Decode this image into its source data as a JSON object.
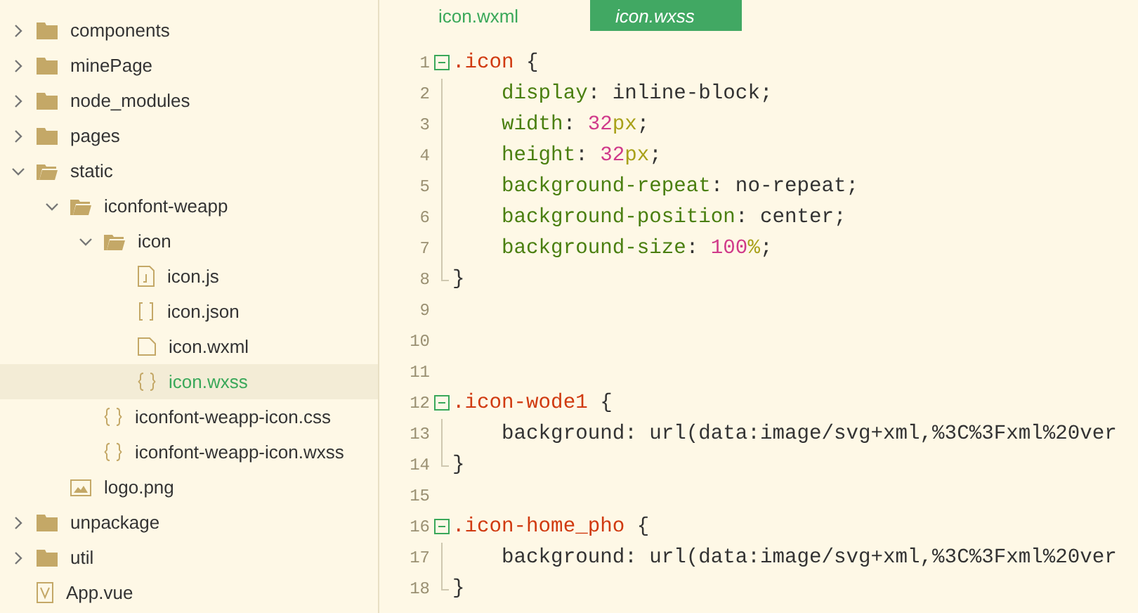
{
  "explorer": {
    "items": [
      {
        "name": "components",
        "kind": "folder",
        "expanded": false,
        "selected": false
      },
      {
        "name": "minePage",
        "kind": "folder",
        "expanded": false,
        "selected": false
      },
      {
        "name": "node_modules",
        "kind": "folder",
        "expanded": false,
        "selected": false
      },
      {
        "name": "pages",
        "kind": "folder",
        "expanded": false,
        "selected": false
      },
      {
        "name": "static",
        "kind": "folder",
        "expanded": true,
        "selected": false,
        "children": [
          {
            "name": "iconfont-weapp",
            "kind": "folder",
            "expanded": true,
            "selected": false,
            "children": [
              {
                "name": "icon",
                "kind": "folder",
                "expanded": true,
                "selected": false,
                "children": [
                  {
                    "name": "icon.js",
                    "kind": "script",
                    "selected": false
                  },
                  {
                    "name": "icon.json",
                    "kind": "json",
                    "selected": false
                  },
                  {
                    "name": "icon.wxml",
                    "kind": "markup",
                    "selected": false
                  },
                  {
                    "name": "icon.wxss",
                    "kind": "style",
                    "selected": true
                  }
                ]
              },
              {
                "name": "iconfont-weapp-icon.css",
                "kind": "style",
                "selected": false
              },
              {
                "name": "iconfont-weapp-icon.wxss",
                "kind": "style",
                "selected": false
              }
            ]
          },
          {
            "name": "logo.png",
            "kind": "image",
            "selected": false
          }
        ]
      },
      {
        "name": "unpackage",
        "kind": "folder",
        "expanded": false,
        "selected": false
      },
      {
        "name": "util",
        "kind": "folder",
        "expanded": false,
        "selected": false
      },
      {
        "name": "App.vue",
        "kind": "vue",
        "selected": false
      }
    ]
  },
  "editor": {
    "tabs": [
      {
        "label": "icon.wxml",
        "selected": false
      },
      {
        "label": "icon.wxss",
        "selected": true
      }
    ],
    "lines": [
      {
        "number": "1",
        "kind": "open",
        "tokens": [
          {
            "kind": "selector",
            "text": ".icon"
          },
          {
            "kind": "plain",
            "text": " {"
          }
        ]
      },
      {
        "number": "2",
        "kind": "body",
        "tokens": [
          {
            "kind": "property",
            "text": "    display"
          },
          {
            "kind": "plain",
            "text": ": inline-block;"
          }
        ]
      },
      {
        "number": "3",
        "kind": "body",
        "tokens": [
          {
            "kind": "property",
            "text": "    width"
          },
          {
            "kind": "plain",
            "text": ": "
          },
          {
            "kind": "number",
            "text": "32"
          },
          {
            "kind": "unit",
            "text": "px"
          },
          {
            "kind": "plain",
            "text": ";"
          }
        ]
      },
      {
        "number": "4",
        "kind": "body",
        "tokens": [
          {
            "kind": "property",
            "text": "    height"
          },
          {
            "kind": "plain",
            "text": ": "
          },
          {
            "kind": "number",
            "text": "32"
          },
          {
            "kind": "unit",
            "text": "px"
          },
          {
            "kind": "plain",
            "text": ";"
          }
        ]
      },
      {
        "number": "5",
        "kind": "body",
        "tokens": [
          {
            "kind": "property",
            "text": "    background-repeat"
          },
          {
            "kind": "plain",
            "text": ": no-repeat;"
          }
        ]
      },
      {
        "number": "6",
        "kind": "body",
        "tokens": [
          {
            "kind": "property",
            "text": "    background-position"
          },
          {
            "kind": "plain",
            "text": ": center;"
          }
        ]
      },
      {
        "number": "7",
        "kind": "body",
        "tokens": [
          {
            "kind": "property",
            "text": "    background-size"
          },
          {
            "kind": "plain",
            "text": ": "
          },
          {
            "kind": "number",
            "text": "100"
          },
          {
            "kind": "unit",
            "text": "%"
          },
          {
            "kind": "plain",
            "text": ";"
          }
        ]
      },
      {
        "number": "8",
        "kind": "end",
        "tokens": [
          {
            "kind": "plain",
            "text": "}"
          }
        ]
      },
      {
        "number": "9",
        "kind": "blank"
      },
      {
        "number": "10",
        "kind": "blank"
      },
      {
        "number": "11",
        "kind": "blank"
      },
      {
        "number": "12",
        "kind": "open",
        "tokens": [
          {
            "kind": "selector",
            "text": ".icon-wode1"
          },
          {
            "kind": "plain",
            "text": " {"
          }
        ]
      },
      {
        "number": "13",
        "kind": "body",
        "tokens": [
          {
            "kind": "plain",
            "text": "    background: url(data:image/svg+xml,%3C%3Fxml%20ver"
          }
        ]
      },
      {
        "number": "14",
        "kind": "end",
        "tokens": [
          {
            "kind": "plain",
            "text": "}"
          }
        ]
      },
      {
        "number": "15",
        "kind": "blank"
      },
      {
        "number": "16",
        "kind": "open",
        "tokens": [
          {
            "kind": "selector",
            "text": ".icon-home_pho"
          },
          {
            "kind": "plain",
            "text": " {"
          }
        ]
      },
      {
        "number": "17",
        "kind": "body",
        "tokens": [
          {
            "kind": "plain",
            "text": "    background: url(data:image/svg+xml,%3C%3Fxml%20ver"
          }
        ]
      },
      {
        "number": "18",
        "kind": "end",
        "tokens": [
          {
            "kind": "plain",
            "text": "}"
          }
        ]
      }
    ]
  }
}
